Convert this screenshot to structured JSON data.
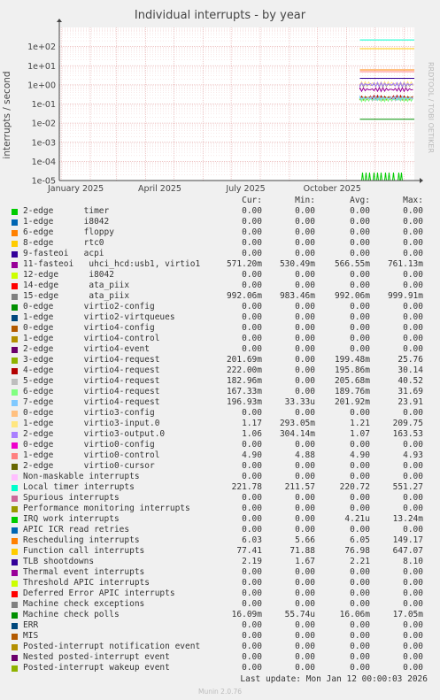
{
  "title": "Individual interrupts - by year",
  "ylabel": "interrupts / second",
  "side_text": "RRDTOOL / TOBI OETIKER",
  "footer_update": "Last update: Mon Jan 12 00:00:03 2026",
  "footer_munin": "Munin 2.0.76",
  "legend_headers": {
    "cur": "Cur:",
    "min": "Min:",
    "avg": "Avg:",
    "max": "Max:"
  },
  "chart_data": {
    "type": "line",
    "title": "Individual interrupts - by year",
    "ylabel": "interrupts / second",
    "yscale": "log",
    "ylim": [
      1e-05,
      1000
    ],
    "y_ticks": [
      "1e+02",
      "1e+01",
      "1e+00",
      "1e-01",
      "1e-02",
      "1e-03",
      "1e-04",
      "1e-05"
    ],
    "x_ticks": [
      "January 2025",
      "April 2025",
      "July 2025",
      "October 2025"
    ],
    "grid": true,
    "data_start": "2025-11-15",
    "series": [
      {
        "name": "2-edge      timer",
        "color": "#00cc00",
        "cur": "0.00",
        "min": "0.00",
        "avg": "0.00",
        "max": "0.00"
      },
      {
        "name": "1-edge      i8042",
        "color": "#0066b3",
        "cur": "0.00",
        "min": "0.00",
        "avg": "0.00",
        "max": "0.00"
      },
      {
        "name": "6-edge      floppy",
        "color": "#ff8000",
        "cur": "0.00",
        "min": "0.00",
        "avg": "0.00",
        "max": "0.00"
      },
      {
        "name": "8-edge      rtc0",
        "color": "#ffcc00",
        "cur": "0.00",
        "min": "0.00",
        "avg": "0.00",
        "max": "0.00"
      },
      {
        "name": "9-fasteoi   acpi",
        "color": "#330099",
        "cur": "0.00",
        "min": "0.00",
        "avg": "0.00",
        "max": "0.00"
      },
      {
        "name": "11-fasteoi   uhci_hcd:usb1, virtio1",
        "color": "#990099",
        "cur": "571.20m",
        "min": "530.49m",
        "avg": "566.55m",
        "max": "761.13m",
        "level": 0.57
      },
      {
        "name": "12-edge      i8042",
        "color": "#ccff00",
        "cur": "0.00",
        "min": "0.00",
        "avg": "0.00",
        "max": "0.00"
      },
      {
        "name": "14-edge      ata_piix",
        "color": "#ff0000",
        "cur": "0.00",
        "min": "0.00",
        "avg": "0.00",
        "max": "0.00"
      },
      {
        "name": "15-edge      ata_piix",
        "color": "#808080",
        "cur": "992.06m",
        "min": "983.46m",
        "avg": "992.06m",
        "max": "999.91m",
        "level": 0.99
      },
      {
        "name": "0-edge      virtio2-config",
        "color": "#008f00",
        "cur": "0.00",
        "min": "0.00",
        "avg": "0.00",
        "max": "0.00"
      },
      {
        "name": "1-edge      virtio2-virtqueues",
        "color": "#00487d",
        "cur": "0.00",
        "min": "0.00",
        "avg": "0.00",
        "max": "0.00"
      },
      {
        "name": "0-edge      virtio4-config",
        "color": "#b35a00",
        "cur": "0.00",
        "min": "0.00",
        "avg": "0.00",
        "max": "0.00"
      },
      {
        "name": "1-edge      virtio4-control",
        "color": "#b38f00",
        "cur": "0.00",
        "min": "0.00",
        "avg": "0.00",
        "max": "0.00"
      },
      {
        "name": "2-edge      virtio4-event",
        "color": "#6b006b",
        "cur": "0.00",
        "min": "0.00",
        "avg": "0.00",
        "max": "0.00"
      },
      {
        "name": "3-edge      virtio4-request",
        "color": "#8fb300",
        "cur": "201.69m",
        "min": "0.00",
        "avg": "199.48m",
        "max": "25.76",
        "level": 0.2
      },
      {
        "name": "4-edge      virtio4-request",
        "color": "#b30000",
        "cur": "222.00m",
        "min": "0.00",
        "avg": "195.86m",
        "max": "30.14",
        "level": 0.22
      },
      {
        "name": "5-edge      virtio4-request",
        "color": "#bebebe",
        "cur": "182.96m",
        "min": "0.00",
        "avg": "205.68m",
        "max": "40.52",
        "level": 0.18
      },
      {
        "name": "6-edge      virtio4-request",
        "color": "#80ff80",
        "cur": "167.33m",
        "min": "0.00",
        "avg": "189.76m",
        "max": "31.69",
        "level": 0.17
      },
      {
        "name": "7-edge      virtio4-request",
        "color": "#80c9ff",
        "cur": "196.93m",
        "min": "33.33u",
        "avg": "201.92m",
        "max": "23.91",
        "level": 0.2
      },
      {
        "name": "0-edge      virtio3-config",
        "color": "#ffc080",
        "cur": "0.00",
        "min": "0.00",
        "avg": "0.00",
        "max": "0.00"
      },
      {
        "name": "1-edge      virtio3-input.0",
        "color": "#ffe680",
        "cur": "1.17",
        "min": "293.05m",
        "avg": "1.21",
        "max": "209.75",
        "level": 1.17
      },
      {
        "name": "2-edge      virtio3-output.0",
        "color": "#aa80ff",
        "cur": "1.06",
        "min": "304.14m",
        "avg": "1.07",
        "max": "163.53",
        "level": 1.06
      },
      {
        "name": "0-edge      virtio0-config",
        "color": "#ee00cc",
        "cur": "0.00",
        "min": "0.00",
        "avg": "0.00",
        "max": "0.00"
      },
      {
        "name": "1-edge      virtio0-control",
        "color": "#ff8080",
        "cur": "4.90",
        "min": "4.88",
        "avg": "4.90",
        "max": "4.93",
        "level": 4.9
      },
      {
        "name": "2-edge      virtio0-cursor",
        "color": "#666600",
        "cur": "0.00",
        "min": "0.00",
        "avg": "0.00",
        "max": "0.00"
      },
      {
        "name": "Non-maskable interrupts",
        "color": "#ffbfff",
        "cur": "0.00",
        "min": "0.00",
        "avg": "0.00",
        "max": "0.00"
      },
      {
        "name": "Local timer interrupts",
        "color": "#00ffcc",
        "cur": "221.78",
        "min": "211.57",
        "avg": "220.72",
        "max": "551.27",
        "level": 221.78
      },
      {
        "name": "Spurious interrupts",
        "color": "#cc6699",
        "cur": "0.00",
        "min": "0.00",
        "avg": "0.00",
        "max": "0.00"
      },
      {
        "name": "Performance monitoring interrupts",
        "color": "#999900",
        "cur": "0.00",
        "min": "0.00",
        "avg": "0.00",
        "max": "0.00"
      },
      {
        "name": "IRQ work interrupts",
        "color": "#00cc00",
        "cur": "0.00",
        "min": "0.00",
        "avg": "4.21u",
        "max": "13.24m"
      },
      {
        "name": "APIC ICR read retries",
        "color": "#0066b3",
        "cur": "0.00",
        "min": "0.00",
        "avg": "0.00",
        "max": "0.00"
      },
      {
        "name": "Rescheduling interrupts",
        "color": "#ff8000",
        "cur": "6.03",
        "min": "5.66",
        "avg": "6.05",
        "max": "149.17",
        "level": 6.03
      },
      {
        "name": "Function call interrupts",
        "color": "#ffcc00",
        "cur": "77.41",
        "min": "71.88",
        "avg": "76.98",
        "max": "647.07",
        "level": 77.41
      },
      {
        "name": "TLB shootdowns",
        "color": "#330099",
        "cur": "2.19",
        "min": "1.67",
        "avg": "2.21",
        "max": "8.10",
        "level": 2.19
      },
      {
        "name": "Thermal event interrupts",
        "color": "#990099",
        "cur": "0.00",
        "min": "0.00",
        "avg": "0.00",
        "max": "0.00"
      },
      {
        "name": "Threshold APIC interrupts",
        "color": "#ccff00",
        "cur": "0.00",
        "min": "0.00",
        "avg": "0.00",
        "max": "0.00"
      },
      {
        "name": "Deferred Error APIC interrupts",
        "color": "#ff0000",
        "cur": "0.00",
        "min": "0.00",
        "avg": "0.00",
        "max": "0.00"
      },
      {
        "name": "Machine check exceptions",
        "color": "#808080",
        "cur": "0.00",
        "min": "0.00",
        "avg": "0.00",
        "max": "0.00"
      },
      {
        "name": "Machine check polls",
        "color": "#008f00",
        "cur": "16.09m",
        "min": "55.74u",
        "avg": "16.06m",
        "max": "17.05m",
        "level": 0.016
      },
      {
        "name": "ERR",
        "color": "#00487d",
        "cur": "0.00",
        "min": "0.00",
        "avg": "0.00",
        "max": "0.00"
      },
      {
        "name": "MIS",
        "color": "#b35a00",
        "cur": "0.00",
        "min": "0.00",
        "avg": "0.00",
        "max": "0.00"
      },
      {
        "name": "Posted-interrupt notification event",
        "color": "#b38f00",
        "cur": "0.00",
        "min": "0.00",
        "avg": "0.00",
        "max": "0.00"
      },
      {
        "name": "Nested posted-interrupt event",
        "color": "#6b006b",
        "cur": "0.00",
        "min": "0.00",
        "avg": "0.00",
        "max": "0.00"
      },
      {
        "name": "Posted-interrupt wakeup event",
        "color": "#8fb300",
        "cur": "0.00",
        "min": "0.00",
        "avg": "0.00",
        "max": "0.00"
      }
    ]
  }
}
